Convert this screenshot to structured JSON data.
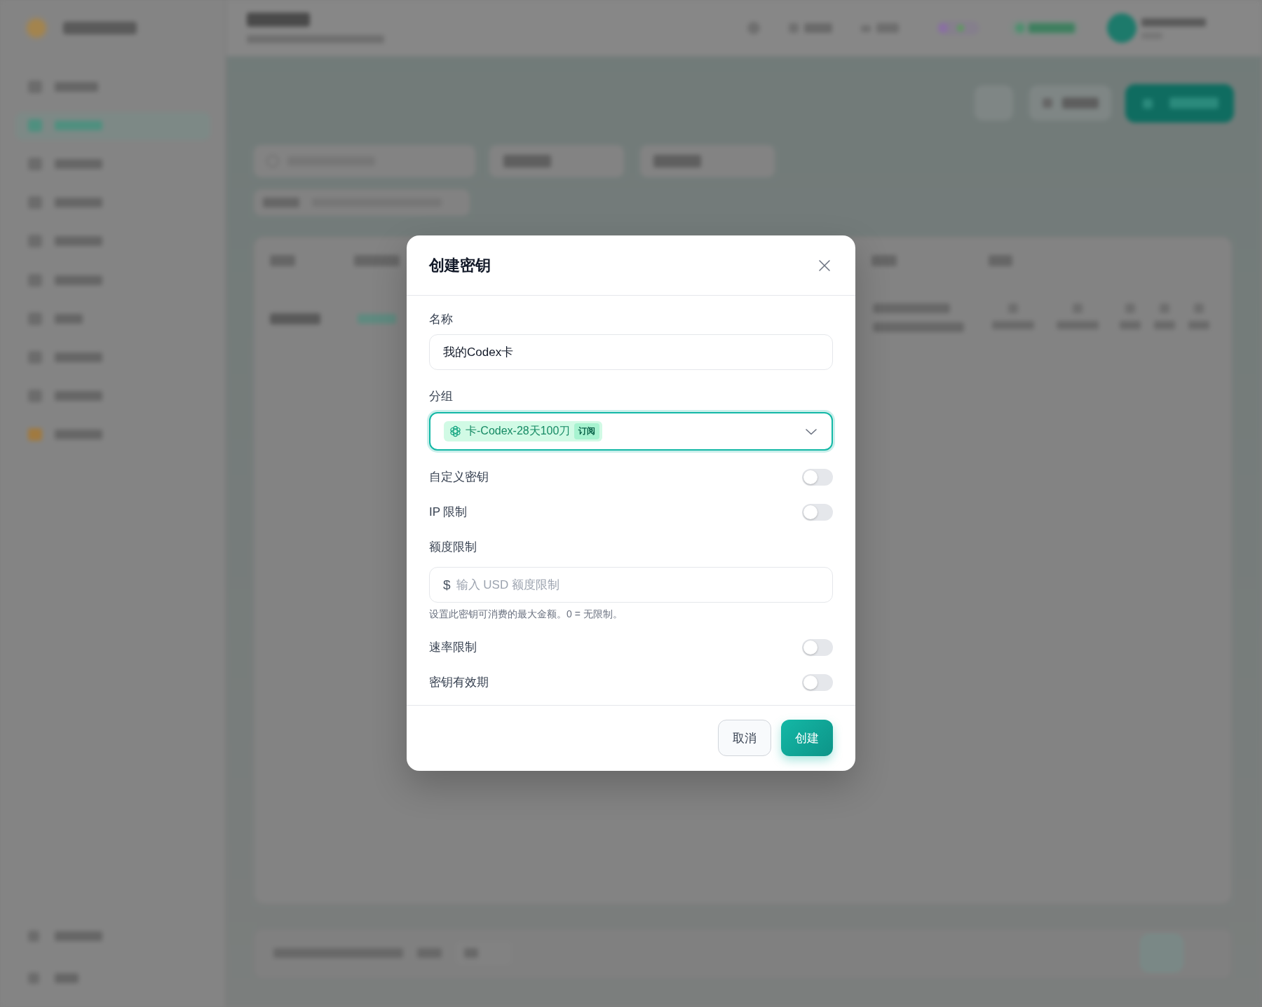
{
  "dialog": {
    "title": "创建密钥",
    "fields": [
      {
        "kind": "text",
        "label": "名称",
        "value": "我的Codex卡"
      },
      {
        "kind": "select",
        "label": "分组",
        "value": "卡-Codex-28天100刀",
        "badge": "订阅",
        "focused": true
      },
      {
        "kind": "toggle",
        "label": "自定义密钥",
        "on": false
      },
      {
        "kind": "toggle",
        "label": "IP 限制",
        "on": false
      },
      {
        "kind": "amount",
        "label": "额度限制",
        "prefix": "$",
        "placeholder": "输入 USD 额度限制",
        "hint": "设置此密钥可消费的最大金额。0 = 无限制。"
      },
      {
        "kind": "toggle",
        "label": "速率限制",
        "on": false
      },
      {
        "kind": "toggle",
        "label": "密钥有效期",
        "on": false
      }
    ],
    "buttons": [
      {
        "kind": "secondary",
        "label": "取消"
      },
      {
        "kind": "primary",
        "label": "创建"
      }
    ]
  }
}
